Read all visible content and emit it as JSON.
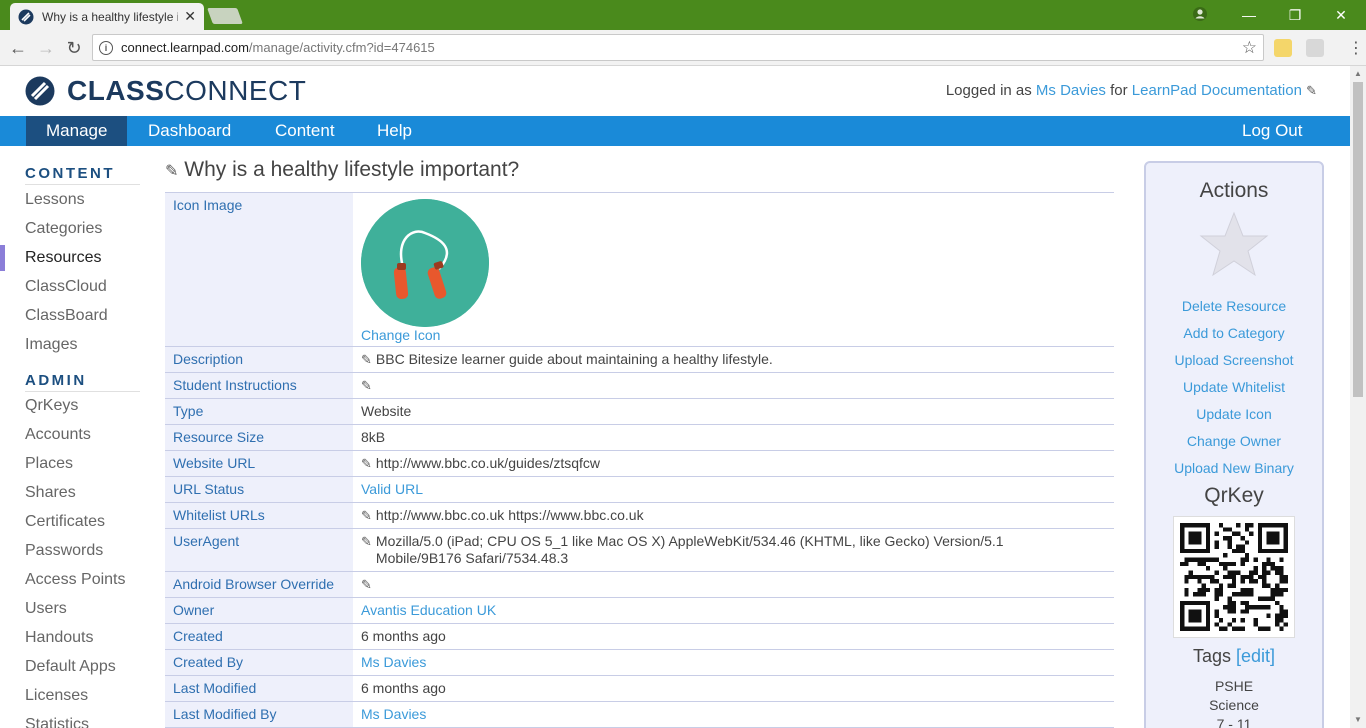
{
  "browser": {
    "tab_title": "Why is a healthy lifestyle important?",
    "url_host": "connect.learnpad.com",
    "url_path": "/manage/activity.cfm?id=474615"
  },
  "header": {
    "logo_bold": "CLASS",
    "logo_light": "CONNECT",
    "logged_in_prefix": "Logged in as",
    "user_name": "Ms Davies",
    "for_text": "for",
    "org_name": "LearnPad Documentation"
  },
  "nav": {
    "items": [
      "Manage",
      "Dashboard",
      "Content",
      "Help"
    ],
    "logout": "Log Out"
  },
  "sidebar": {
    "content_heading": "CONTENT",
    "content_items": [
      "Lessons",
      "Categories",
      "Resources",
      "ClassCloud",
      "ClassBoard",
      "Images"
    ],
    "admin_heading": "ADMIN",
    "admin_items": [
      "QrKeys",
      "Accounts",
      "Places",
      "Shares",
      "Certificates",
      "Passwords",
      "Access Points",
      "Users",
      "Handouts",
      "Default Apps",
      "Licenses",
      "Statistics"
    ]
  },
  "page": {
    "title": "Why is a healthy lifestyle important?",
    "change_icon": "Change Icon",
    "rows": {
      "icon_image": "Icon Image",
      "description_label": "Description",
      "description": "BBC Bitesize learner guide about maintaining a healthy lifestyle.",
      "instructions_label": "Student Instructions",
      "type_label": "Type",
      "type": "Website",
      "size_label": "Resource Size",
      "size": "8kB",
      "website_url_label": "Website URL",
      "website_url": "http://www.bbc.co.uk/guides/ztsqfcw",
      "url_status_label": "URL Status",
      "url_status": "Valid URL",
      "whitelist_label": "Whitelist URLs",
      "whitelist": "http://www.bbc.co.uk https://www.bbc.co.uk",
      "useragent_label": "UserAgent",
      "useragent_line1": "Mozilla/5.0 (iPad; CPU OS 5_1 like Mac OS X) AppleWebKit/534.46 (KHTML, like Gecko) Version/5.1",
      "useragent_line2": "Mobile/9B176 Safari/7534.48.3",
      "android_label": "Android Browser Override",
      "owner_label": "Owner",
      "owner": "Avantis Education UK",
      "created_label": "Created",
      "created": "6 months ago",
      "created_by_label": "Created By",
      "created_by": "Ms Davies",
      "modified_label": "Last Modified",
      "modified": "6 months ago",
      "modified_by_label": "Last Modified By",
      "modified_by": "Ms Davies"
    }
  },
  "actions": {
    "title": "Actions",
    "links": [
      "Delete Resource",
      "Add to Category",
      "Upload Screenshot",
      "Update Whitelist",
      "Update Icon",
      "Change Owner",
      "Upload New Binary"
    ],
    "qrkey_title": "QrKey",
    "tags_title": "Tags",
    "tags_edit": "[edit]",
    "tags": [
      "PSHE",
      "Science",
      "7 - 11"
    ]
  },
  "colors": {
    "nav_blue": "#1a8ad8",
    "nav_active": "#1c4f80",
    "link": "#3b9ad9",
    "icon_bg": "#3fb09a"
  }
}
